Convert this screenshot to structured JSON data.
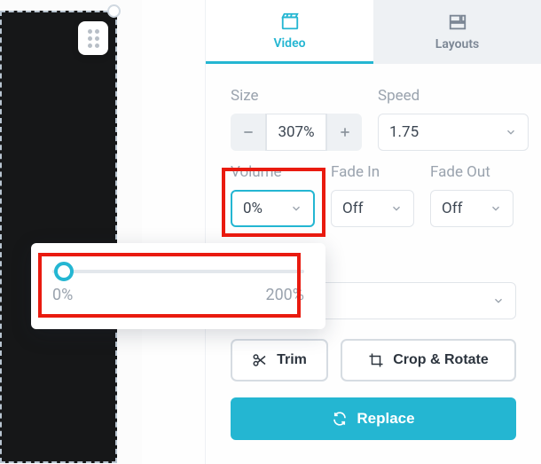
{
  "tabs": {
    "video_label": "Video",
    "layouts_label": "Layouts"
  },
  "labels": {
    "size": "Size",
    "speed": "Speed",
    "volume": "Volume",
    "fade_in": "Fade In",
    "fade_out": "Fade Out"
  },
  "values": {
    "size": "307%",
    "speed": "1.75",
    "volume": "0%",
    "fade_in": "Off",
    "fade_out": "Off"
  },
  "slider": {
    "min_label": "0%",
    "max_label": "200%"
  },
  "buttons": {
    "trim": "Trim",
    "crop": "Crop & Rotate",
    "replace": "Replace"
  }
}
